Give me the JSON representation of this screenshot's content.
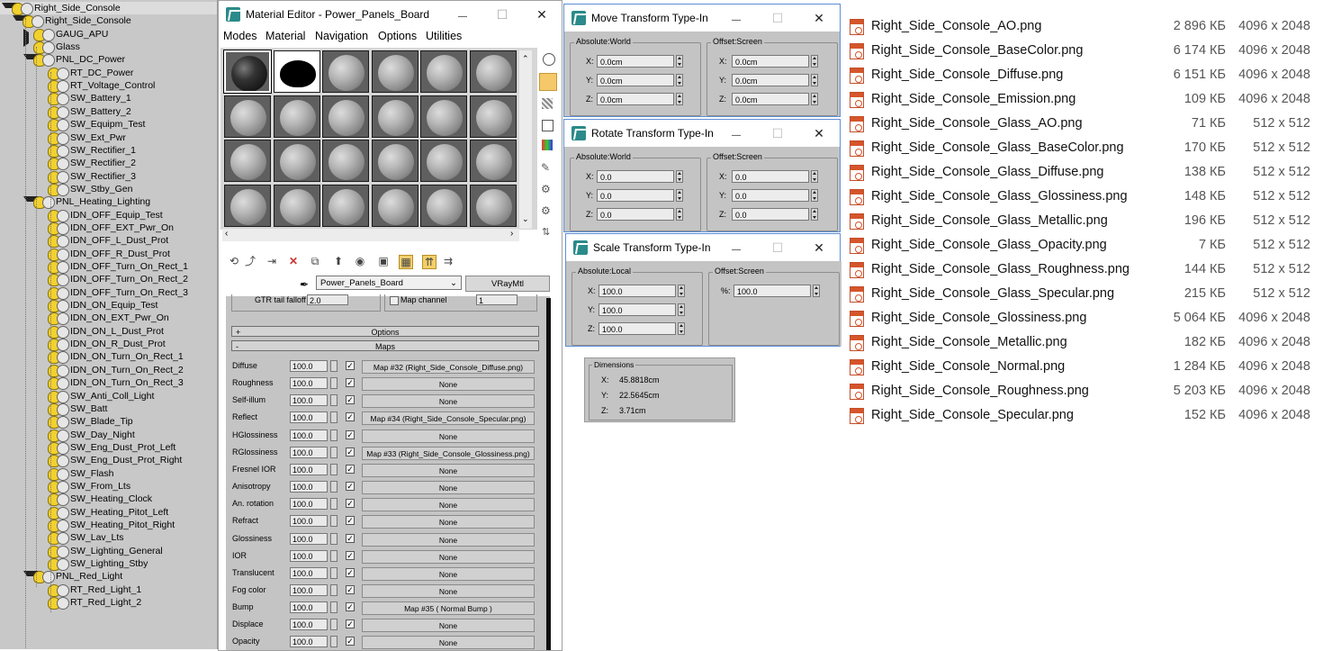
{
  "scene_tree": {
    "items": [
      {
        "label": "Right_Side_Console",
        "level": 0,
        "expander": "down"
      },
      {
        "label": "Right_Side_Console",
        "level": 1,
        "expander": "down"
      },
      {
        "label": "GAUG_APU",
        "level": 2,
        "expander": "right"
      },
      {
        "label": "Glass",
        "level": 2,
        "expander": ""
      },
      {
        "label": "PNL_DC_Power",
        "level": 2,
        "expander": "down"
      },
      {
        "label": "RT_DC_Power",
        "level": 3,
        "expander": ""
      },
      {
        "label": "RT_Voltage_Control",
        "level": 3,
        "expander": ""
      },
      {
        "label": "SW_Battery_1",
        "level": 3,
        "expander": ""
      },
      {
        "label": "SW_Battery_2",
        "level": 3,
        "expander": ""
      },
      {
        "label": "SW_Equipm_Test",
        "level": 3,
        "expander": ""
      },
      {
        "label": "SW_Ext_Pwr",
        "level": 3,
        "expander": ""
      },
      {
        "label": "SW_Rectifier_1",
        "level": 3,
        "expander": ""
      },
      {
        "label": "SW_Rectifier_2",
        "level": 3,
        "expander": ""
      },
      {
        "label": "SW_Rectifier_3",
        "level": 3,
        "expander": ""
      },
      {
        "label": "SW_Stby_Gen",
        "level": 3,
        "expander": ""
      },
      {
        "label": "PNL_Heating_Lighting",
        "level": 2,
        "expander": "down"
      },
      {
        "label": "IDN_OFF_Equip_Test",
        "level": 3,
        "expander": ""
      },
      {
        "label": "IDN_OFF_EXT_Pwr_On",
        "level": 3,
        "expander": ""
      },
      {
        "label": "IDN_OFF_L_Dust_Prot",
        "level": 3,
        "expander": ""
      },
      {
        "label": "IDN_OFF_R_Dust_Prot",
        "level": 3,
        "expander": ""
      },
      {
        "label": "IDN_OFF_Turn_On_Rect_1",
        "level": 3,
        "expander": ""
      },
      {
        "label": "IDN_OFF_Turn_On_Rect_2",
        "level": 3,
        "expander": ""
      },
      {
        "label": "IDN_OFF_Turn_On_Rect_3",
        "level": 3,
        "expander": ""
      },
      {
        "label": "IDN_ON_Equip_Test",
        "level": 3,
        "expander": ""
      },
      {
        "label": "IDN_ON_EXT_Pwr_On",
        "level": 3,
        "expander": ""
      },
      {
        "label": "IDN_ON_L_Dust_Prot",
        "level": 3,
        "expander": ""
      },
      {
        "label": "IDN_ON_R_Dust_Prot",
        "level": 3,
        "expander": ""
      },
      {
        "label": "IDN_ON_Turn_On_Rect_1",
        "level": 3,
        "expander": ""
      },
      {
        "label": "IDN_ON_Turn_On_Rect_2",
        "level": 3,
        "expander": ""
      },
      {
        "label": "IDN_ON_Turn_On_Rect_3",
        "level": 3,
        "expander": ""
      },
      {
        "label": "SW_Anti_Coll_Light",
        "level": 3,
        "expander": ""
      },
      {
        "label": "SW_Batt",
        "level": 3,
        "expander": ""
      },
      {
        "label": "SW_Blade_Tip",
        "level": 3,
        "expander": ""
      },
      {
        "label": "SW_Day_Night",
        "level": 3,
        "expander": ""
      },
      {
        "label": "SW_Eng_Dust_Prot_Left",
        "level": 3,
        "expander": ""
      },
      {
        "label": "SW_Eng_Dust_Prot_Right",
        "level": 3,
        "expander": ""
      },
      {
        "label": "SW_Flash",
        "level": 3,
        "expander": ""
      },
      {
        "label": "SW_From_Lts",
        "level": 3,
        "expander": ""
      },
      {
        "label": "SW_Heating_Clock",
        "level": 3,
        "expander": ""
      },
      {
        "label": "SW_Heating_Pitot_Left",
        "level": 3,
        "expander": ""
      },
      {
        "label": "SW_Heating_Pitot_Right",
        "level": 3,
        "expander": ""
      },
      {
        "label": "SW_Lav_Lts",
        "level": 3,
        "expander": ""
      },
      {
        "label": "SW_Lighting_General",
        "level": 3,
        "expander": ""
      },
      {
        "label": "SW_Lighting_Stby",
        "level": 3,
        "expander": ""
      },
      {
        "label": "PNL_Red_Light",
        "level": 2,
        "expander": "down"
      },
      {
        "label": "RT_Red_Light_1",
        "level": 3,
        "expander": ""
      },
      {
        "label": "RT_Red_Light_2",
        "level": 3,
        "expander": ""
      }
    ]
  },
  "material_editor": {
    "title": "Material Editor - Power_Panels_Board",
    "menu": [
      "Modes",
      "Material",
      "Navigation",
      "Options",
      "Utilities"
    ],
    "material_name": "Power_Panels_Board",
    "material_type": "VRayMtl",
    "partial_row": {
      "left_label": "GTR tail falloff",
      "left_value": "2.0",
      "right_label": "Map channel",
      "right_value": "1"
    },
    "rollout_options": "Options",
    "rollout_maps": "Maps",
    "maps": [
      {
        "label": "Diffuse",
        "value": "100.0",
        "checked": "✓",
        "map": "Map #32 (Right_Side_Console_Diffuse.png)"
      },
      {
        "label": "Roughness",
        "value": "100.0",
        "checked": "✓",
        "map": "None"
      },
      {
        "label": "Self-illum",
        "value": "100.0",
        "checked": "✓",
        "map": "None"
      },
      {
        "label": "Reflect",
        "value": "100.0",
        "checked": "✓",
        "map": "Map #34 (Right_Side_Console_Specular.png)"
      },
      {
        "label": "HGlossiness",
        "value": "100.0",
        "checked": "✓",
        "map": "None"
      },
      {
        "label": "RGlossiness",
        "value": "100.0",
        "checked": "✓",
        "map": "Map #33 (Right_Side_Console_Glossiness.png)"
      },
      {
        "label": "Fresnel IOR",
        "value": "100.0",
        "checked": "✓",
        "map": "None"
      },
      {
        "label": "Anisotropy",
        "value": "100.0",
        "checked": "✓",
        "map": "None"
      },
      {
        "label": "An. rotation",
        "value": "100.0",
        "checked": "✓",
        "map": "None"
      },
      {
        "label": "Refract",
        "value": "100.0",
        "checked": "✓",
        "map": "None"
      },
      {
        "label": "Glossiness",
        "value": "100.0",
        "checked": "✓",
        "map": "None"
      },
      {
        "label": "IOR",
        "value": "100.0",
        "checked": "✓",
        "map": "None"
      },
      {
        "label": "Translucent",
        "value": "100.0",
        "checked": "✓",
        "map": "None"
      },
      {
        "label": "Fog color",
        "value": "100.0",
        "checked": "✓",
        "map": "None"
      },
      {
        "label": "Bump",
        "value": "100.0",
        "checked": "✓",
        "map": "Map #35  ( Normal Bump )"
      },
      {
        "label": "Displace",
        "value": "100.0",
        "checked": "✓",
        "map": "None"
      },
      {
        "label": "Opacity",
        "value": "100.0",
        "checked": "✓",
        "map": "None"
      }
    ]
  },
  "move_dialog": {
    "title": "Move Transform Type-In",
    "left_group": "Absolute:World",
    "right_group": "Offset:Screen",
    "left": [
      {
        "axis": "X:",
        "value": "0.0cm"
      },
      {
        "axis": "Y:",
        "value": "0.0cm"
      },
      {
        "axis": "Z:",
        "value": "0.0cm"
      }
    ],
    "right": [
      {
        "axis": "X:",
        "value": "0.0cm"
      },
      {
        "axis": "Y:",
        "value": "0.0cm"
      },
      {
        "axis": "Z:",
        "value": "0.0cm"
      }
    ]
  },
  "rotate_dialog": {
    "title": "Rotate Transform Type-In",
    "left_group": "Absolute:World",
    "right_group": "Offset:Screen",
    "left": [
      {
        "axis": "X:",
        "value": "0.0"
      },
      {
        "axis": "Y:",
        "value": "0.0"
      },
      {
        "axis": "Z:",
        "value": "0.0"
      }
    ],
    "right": [
      {
        "axis": "X:",
        "value": "0.0"
      },
      {
        "axis": "Y:",
        "value": "0.0"
      },
      {
        "axis": "Z:",
        "value": "0.0"
      }
    ]
  },
  "scale_dialog": {
    "title": "Scale Transform Type-In",
    "left_group": "Absolute:Local",
    "right_group": "Offset:Screen",
    "left": [
      {
        "axis": "X:",
        "value": "100.0"
      },
      {
        "axis": "Y:",
        "value": "100.0"
      },
      {
        "axis": "Z:",
        "value": "100.0"
      }
    ],
    "right": [
      {
        "axis": "%:",
        "value": "100.0"
      }
    ]
  },
  "dimensions": {
    "title": "Dimensions",
    "rows": [
      {
        "axis": "X:",
        "value": "45.8818cm"
      },
      {
        "axis": "Y:",
        "value": "22.5645cm"
      },
      {
        "axis": "Z:",
        "value": "3.71cm"
      }
    ]
  },
  "files": [
    {
      "name": "Right_Side_Console_AO.png",
      "size": "2 896 КБ",
      "dims": "4096 x 2048"
    },
    {
      "name": "Right_Side_Console_BaseColor.png",
      "size": "6 174 КБ",
      "dims": "4096 x 2048"
    },
    {
      "name": "Right_Side_Console_Diffuse.png",
      "size": "6 151 КБ",
      "dims": "4096 x 2048"
    },
    {
      "name": "Right_Side_Console_Emission.png",
      "size": "109 КБ",
      "dims": "4096 x 2048"
    },
    {
      "name": "Right_Side_Console_Glass_AO.png",
      "size": "71 КБ",
      "dims": "512 x 512"
    },
    {
      "name": "Right_Side_Console_Glass_BaseColor.png",
      "size": "170 КБ",
      "dims": "512 x 512"
    },
    {
      "name": "Right_Side_Console_Glass_Diffuse.png",
      "size": "138 КБ",
      "dims": "512 x 512"
    },
    {
      "name": "Right_Side_Console_Glass_Glossiness.png",
      "size": "148 КБ",
      "dims": "512 x 512"
    },
    {
      "name": "Right_Side_Console_Glass_Metallic.png",
      "size": "196 КБ",
      "dims": "512 x 512"
    },
    {
      "name": "Right_Side_Console_Glass_Opacity.png",
      "size": "7 КБ",
      "dims": "512 x 512"
    },
    {
      "name": "Right_Side_Console_Glass_Roughness.png",
      "size": "144 КБ",
      "dims": "512 x 512"
    },
    {
      "name": "Right_Side_Console_Glass_Specular.png",
      "size": "215 КБ",
      "dims": "512 x 512"
    },
    {
      "name": "Right_Side_Console_Glossiness.png",
      "size": "5 064 КБ",
      "dims": "4096 x 2048"
    },
    {
      "name": "Right_Side_Console_Metallic.png",
      "size": "182 КБ",
      "dims": "4096 x 2048"
    },
    {
      "name": "Right_Side_Console_Normal.png",
      "size": "1 284 КБ",
      "dims": "4096 x 2048"
    },
    {
      "name": "Right_Side_Console_Roughness.png",
      "size": "5 203 КБ",
      "dims": "4096 x 2048"
    },
    {
      "name": "Right_Side_Console_Specular.png",
      "size": "152 КБ",
      "dims": "4096 x 2048"
    }
  ],
  "window_buttons": {
    "minimize": "—",
    "maximize": "☐",
    "close": "✕"
  }
}
